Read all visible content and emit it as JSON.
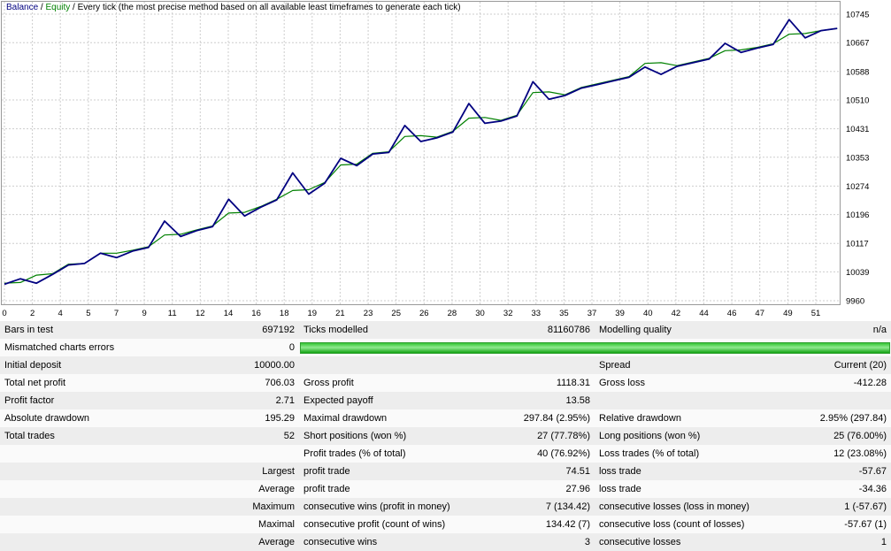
{
  "chart": {
    "legend": {
      "balance": "Balance",
      "equity": "Equity",
      "sep": " / ",
      "method": "Every tick (the most precise method based on all available least timeframes to generate each tick)"
    }
  },
  "chart_data": {
    "type": "line",
    "title": "Balance / Equity",
    "xlabel": "",
    "ylabel": "",
    "grid": true,
    "legend_position": "top-left",
    "grid_color": "#cdcdcd",
    "border_color": "#999999",
    "xlim": [
      0,
      52
    ],
    "ylim": [
      9960,
      10745
    ],
    "y_ticks": [
      10745,
      10667,
      10588,
      10510,
      10431,
      10353,
      10274,
      10196,
      10117,
      10039,
      9960
    ],
    "x_tick_labels": [
      "0",
      "2",
      "4",
      "5",
      "7",
      "9",
      "11",
      "12",
      "14",
      "16",
      "18",
      "19",
      "21",
      "23",
      "25",
      "26",
      "28",
      "30",
      "32",
      "33",
      "35",
      "37",
      "39",
      "40",
      "42",
      "44",
      "46",
      "47",
      "49",
      "51"
    ],
    "x": [
      0,
      1,
      2,
      3,
      4,
      5,
      6,
      7,
      8,
      9,
      10,
      11,
      12,
      13,
      14,
      15,
      16,
      17,
      18,
      19,
      20,
      21,
      22,
      23,
      24,
      25,
      26,
      27,
      28,
      29,
      30,
      31,
      32,
      33,
      34,
      35,
      36,
      37,
      38,
      39,
      40,
      41,
      42,
      43,
      44,
      45,
      46,
      47,
      48,
      49,
      50,
      51,
      52
    ],
    "series": [
      {
        "name": "Balance",
        "color": "#000080",
        "values": [
          10005,
          10020,
          10008,
          10032,
          10058,
          10062,
          10090,
          10078,
          10096,
          10106,
          10178,
          10136,
          10152,
          10163,
          10238,
          10192,
          10216,
          10236,
          10310,
          10252,
          10282,
          10350,
          10330,
          10362,
          10366,
          10440,
          10396,
          10406,
          10422,
          10500,
          10446,
          10452,
          10466,
          10560,
          10512,
          10522,
          10542,
          10552,
          10562,
          10572,
          10600,
          10580,
          10602,
          10612,
          10622,
          10665,
          10640,
          10652,
          10662,
          10730,
          10680,
          10700,
          10706
        ]
      },
      {
        "name": "Equity",
        "color": "#008000",
        "values": [
          10008,
          10010,
          10030,
          10034,
          10060,
          10062,
          10090,
          10090,
          10098,
          10108,
          10140,
          10142,
          10154,
          10165,
          10200,
          10202,
          10218,
          10238,
          10262,
          10264,
          10284,
          10332,
          10334,
          10364,
          10368,
          10410,
          10412,
          10408,
          10424,
          10460,
          10462,
          10454,
          10468,
          10530,
          10532,
          10524,
          10544,
          10554,
          10564,
          10574,
          10610,
          10612,
          10604,
          10614,
          10624,
          10645,
          10647,
          10654,
          10664,
          10690,
          10692,
          10700,
          10706
        ]
      }
    ]
  },
  "table": {
    "modelling_quality_bar_color": "#33cc33",
    "rows": [
      {
        "cells": [
          "Bars in test",
          "697192",
          "Ticks modelled",
          "81160786",
          "Modelling quality",
          "n/a"
        ]
      },
      {
        "cells": [
          "Mismatched charts errors",
          "0"
        ],
        "quality_bar": true
      },
      {
        "cells": [
          "Initial deposit",
          "10000.00",
          "",
          "",
          "Spread",
          "Current (20)"
        ]
      },
      {
        "cells": [
          "Total net profit",
          "706.03",
          "Gross profit",
          "1118.31",
          "Gross loss",
          "-412.28"
        ]
      },
      {
        "cells": [
          "Profit factor",
          "2.71",
          "Expected payoff",
          "13.58",
          "",
          ""
        ]
      },
      {
        "cells": [
          "Absolute drawdown",
          "195.29",
          "Maximal drawdown",
          "297.84 (2.95%)",
          "Relative drawdown",
          "2.95% (297.84)"
        ]
      },
      {
        "cells": [
          "Total trades",
          "52",
          "Short positions (won %)",
          "27 (77.78%)",
          "Long positions (won %)",
          "25 (76.00%)"
        ]
      },
      {
        "cells": [
          "",
          "",
          "Profit trades (% of total)",
          "40 (76.92%)",
          "Loss trades (% of total)",
          "12 (23.08%)"
        ]
      },
      {
        "cells": [
          "",
          "Largest",
          "profit trade",
          "74.51",
          "loss trade",
          "-57.67"
        ]
      },
      {
        "cells": [
          "",
          "Average",
          "profit trade",
          "27.96",
          "loss trade",
          "-34.36"
        ]
      },
      {
        "cells": [
          "",
          "Maximum",
          "consecutive wins (profit in money)",
          "7 (134.42)",
          "consecutive losses (loss in money)",
          "1 (-57.67)"
        ]
      },
      {
        "cells": [
          "",
          "Maximal",
          "consecutive profit (count of wins)",
          "134.42 (7)",
          "consecutive loss (count of losses)",
          "-57.67 (1)"
        ]
      },
      {
        "cells": [
          "",
          "Average",
          "consecutive wins",
          "3",
          "consecutive losses",
          "1"
        ]
      }
    ]
  }
}
